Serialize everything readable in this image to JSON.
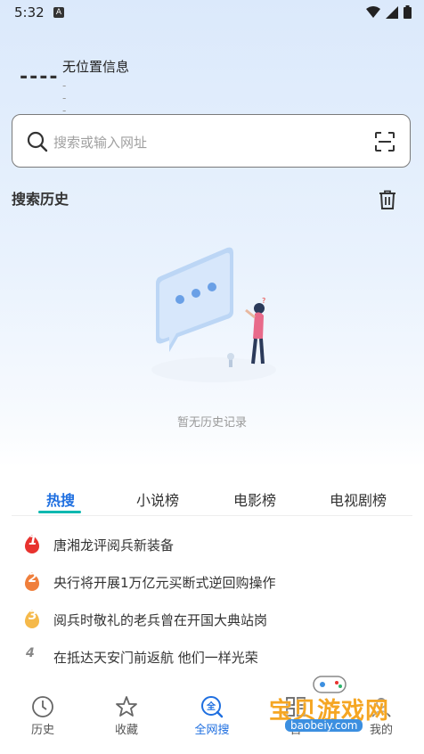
{
  "status_bar": {
    "time": "5:32",
    "badge": "A",
    "icons": [
      "wifi-icon",
      "signal-icon",
      "battery-icon"
    ]
  },
  "location": {
    "temperature": "----",
    "title": "无位置信息",
    "subtitle": "----"
  },
  "search": {
    "placeholder": "搜索或输入网址"
  },
  "history": {
    "title": "搜索历史",
    "empty_text": "暂无历史记录"
  },
  "tabs": [
    {
      "label": "热搜",
      "active": true
    },
    {
      "label": "小说榜",
      "active": false
    },
    {
      "label": "电影榜",
      "active": false
    },
    {
      "label": "电视剧榜",
      "active": false
    }
  ],
  "hot_list": [
    {
      "rank": "1",
      "text": "唐湘龙评阅兵新装备"
    },
    {
      "rank": "2",
      "text": "央行将开展1万亿元买断式逆回购操作"
    },
    {
      "rank": "3",
      "text": "阅兵时敬礼的老兵曾在开国大典站岗"
    },
    {
      "rank": "4",
      "text": "在抵达天安门前返航 他们一样光荣"
    }
  ],
  "bottom_nav": [
    {
      "label": "历史",
      "icon": "clock-icon"
    },
    {
      "label": "收藏",
      "icon": "star-icon"
    },
    {
      "label": "全网搜",
      "icon": "global-search-icon",
      "active": true
    },
    {
      "label": "百",
      "icon": "grid-icon"
    },
    {
      "label": "我的",
      "icon": "user-icon"
    }
  ],
  "watermark": {
    "text": "宝贝游戏网",
    "url": "baobeiy.com"
  },
  "colors": {
    "accent": "#1f6fe0",
    "tab_underline": "#0ab8b0",
    "rank1": "#e8322e",
    "rank2": "#f07f3c",
    "rank3": "#f5b94a"
  }
}
